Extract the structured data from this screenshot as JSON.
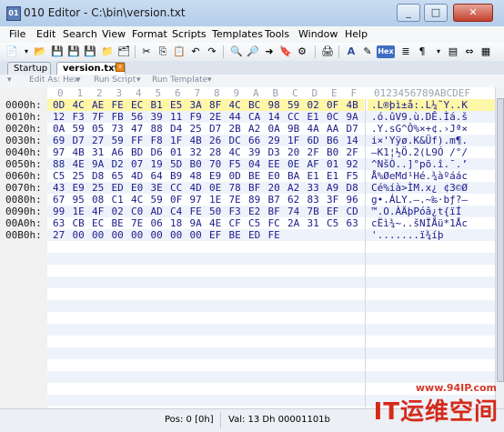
{
  "window": {
    "title": "010 Editor - C:\\bin\\version.txt"
  },
  "menu": [
    "File",
    "Edit",
    "Search",
    "View",
    "Format",
    "Scripts",
    "Templates",
    "Tools",
    "Window",
    "Help"
  ],
  "tabs": [
    {
      "label": "Startup"
    },
    {
      "label": "version.txt"
    }
  ],
  "subtoolbar": {
    "edit_as": "Edit As: Hex",
    "run_script": "Run Script",
    "run_template": "Run Template"
  },
  "columns": [
    "0",
    "1",
    "2",
    "3",
    "4",
    "5",
    "6",
    "7",
    "8",
    "9",
    "A",
    "B",
    "C",
    "D",
    "E",
    "F"
  ],
  "ascii_header": "0123456789ABCDEF",
  "rows": [
    {
      "addr": "0000h:",
      "bytes": [
        "0D",
        "4C",
        "AE",
        "FE",
        "EC",
        "B1",
        "E5",
        "3A",
        "8F",
        "4C",
        "BC",
        "98",
        "59",
        "02",
        "0F",
        "4B"
      ],
      "ascii": ".L®þì±å:.L¼˜Y..K"
    },
    {
      "addr": "0010h:",
      "bytes": [
        "12",
        "F3",
        "7F",
        "FB",
        "56",
        "39",
        "11",
        "F9",
        "2E",
        "44",
        "CA",
        "14",
        "CC",
        "E1",
        "0C",
        "9A"
      ],
      "ascii": ".ó.ûV9.ù.DÊ.Ìá.š"
    },
    {
      "addr": "0020h:",
      "bytes": [
        "0A",
        "59",
        "05",
        "73",
        "47",
        "88",
        "D4",
        "25",
        "D7",
        "2B",
        "A2",
        "0A",
        "9B",
        "4A",
        "AA",
        "D7"
      ],
      "ascii": ".Y.sG^Ô%×+¢.›Jª×"
    },
    {
      "addr": "0030h:",
      "bytes": [
        "69",
        "D7",
        "27",
        "59",
        "FF",
        "F8",
        "1F",
        "4B",
        "26",
        "DC",
        "66",
        "29",
        "1F",
        "6D",
        "B6",
        "14"
      ],
      "ascii": "i×'Yÿø.K&Üf).m¶."
    },
    {
      "addr": "0040h:",
      "bytes": [
        "97",
        "4B",
        "31",
        "A6",
        "BD",
        "D6",
        "01",
        "32",
        "28",
        "4C",
        "39",
        "D3",
        "20",
        "2F",
        "B0",
        "2F"
      ],
      "ascii": "—K1¦½Ö.2(L9Ó /°/"
    },
    {
      "addr": "0050h:",
      "bytes": [
        "88",
        "4E",
        "9A",
        "D2",
        "07",
        "19",
        "5D",
        "B0",
        "70",
        "F5",
        "04",
        "EE",
        "0E",
        "AF",
        "01",
        "92"
      ],
      "ascii": "^NšÒ..]°põ.î.¯.’"
    },
    {
      "addr": "0060h:",
      "bytes": [
        "C5",
        "25",
        "D8",
        "65",
        "4D",
        "64",
        "B9",
        "48",
        "E9",
        "0D",
        "BE",
        "E0",
        "BA",
        "E1",
        "E1",
        "F5"
      ],
      "ascii": "Å%ØeMd¹Hé.¾àºáác"
    },
    {
      "addr": "0070h:",
      "bytes": [
        "43",
        "E9",
        "25",
        "ED",
        "E0",
        "3E",
        "CC",
        "4D",
        "0E",
        "78",
        "BF",
        "20",
        "A2",
        "33",
        "A9",
        "D8"
      ],
      "ascii": "Cé%íà>ÌM.x¿ ¢3©Ø"
    },
    {
      "addr": "0080h:",
      "bytes": [
        "67",
        "95",
        "08",
        "C1",
        "4C",
        "59",
        "0F",
        "97",
        "1E",
        "7E",
        "89",
        "B7",
        "62",
        "83",
        "3F",
        "96"
      ],
      "ascii": "g•.ÁLY.—.~‰·bƒ?–"
    },
    {
      "addr": "0090h:",
      "bytes": [
        "99",
        "1E",
        "4F",
        "02",
        "C0",
        "AD",
        "C4",
        "FE",
        "50",
        "F3",
        "E2",
        "BF",
        "74",
        "7B",
        "EF",
        "CD"
      ],
      "ascii": "™.O.À­ÄþPóâ¿t{ïÍ"
    },
    {
      "addr": "00A0h:",
      "bytes": [
        "63",
        "CB",
        "EC",
        "BE",
        "7E",
        "06",
        "18",
        "9A",
        "4E",
        "CF",
        "C5",
        "FC",
        "2A",
        "31",
        "C5",
        "63"
      ],
      "ascii": "cËì¾~..šNÏÅü*1Åc"
    },
    {
      "addr": "00B0h:",
      "bytes": [
        "27",
        "00",
        "00",
        "00",
        "00",
        "00",
        "00",
        "00",
        "EF",
        "BE",
        "ED",
        "FE"
      ],
      "ascii": "'.......ï¾íþ"
    }
  ],
  "status": {
    "pos": "Pos: 0 [0h]",
    "val": "Val: 13 Dh 00001101b"
  },
  "watermark": {
    "url": "www.94IP.com",
    "logo": "IT运维空间"
  }
}
